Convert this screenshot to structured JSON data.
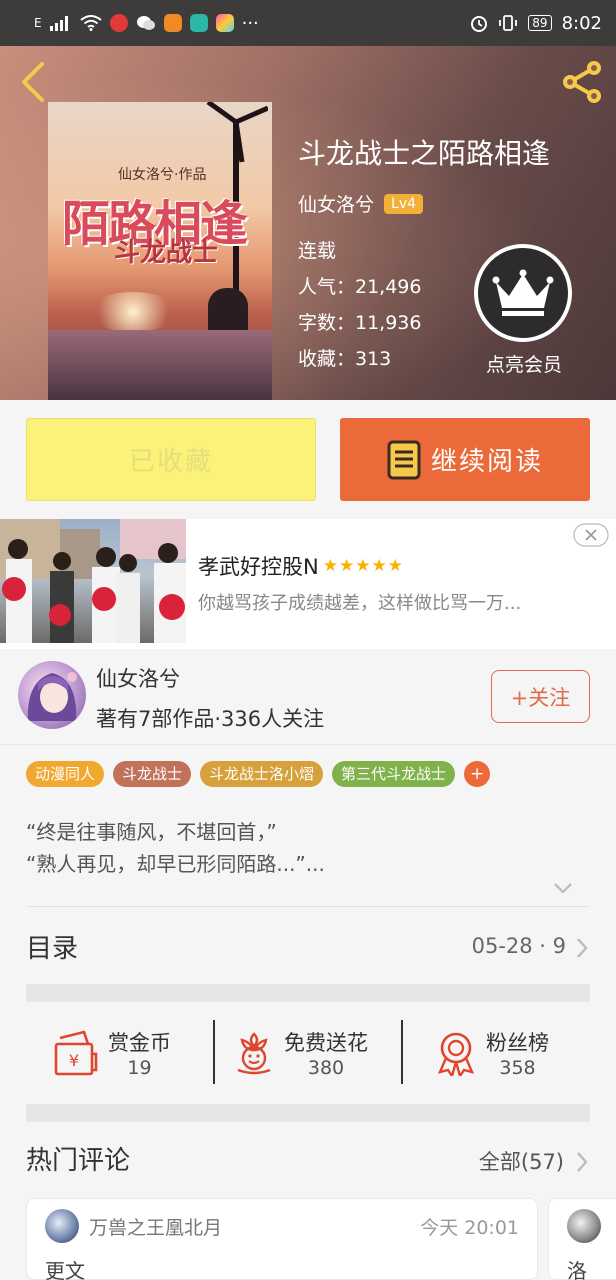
{
  "status_bar": {
    "signal": "E",
    "time": "8:02",
    "battery": "89",
    "more": "···"
  },
  "book": {
    "title": "斗龙战士之陌路相逢",
    "author": "仙女洛兮",
    "level": "Lv4",
    "status": "连载",
    "popularity": "人气：21,496",
    "word_count": "字数：11,936",
    "favorites": "收藏：313",
    "cover": {
      "author_line": "仙女洛兮·作品",
      "title_line": "陌路相逢",
      "subtitle_line": "斗龙战士"
    }
  },
  "vip": {
    "label": "点亮会员"
  },
  "actions": {
    "favorited_label": "已收藏",
    "continue_label": "继续阅读"
  },
  "ad": {
    "title": "孝武好控股N",
    "stars": "★★★★★",
    "description": "你越骂孩子成绩越差，这样做比骂一万..."
  },
  "author_card": {
    "name": "仙女洛兮",
    "stats": "著有7部作品·336人关注",
    "follow_label": "+关注"
  },
  "tags": [
    {
      "label": "动漫同人",
      "color": "#f0a830"
    },
    {
      "label": "斗龙战士",
      "color": "#c0735a"
    },
    {
      "label": "斗龙战士洛小熠",
      "color": "#d6a03a"
    },
    {
      "label": "第三代斗龙战士",
      "color": "#7fb24a"
    }
  ],
  "tag_more": "+",
  "intro": {
    "line1": "“终是往事随风，不堪回首，”",
    "line2": "“熟人再见，却早已形同陌路...”..."
  },
  "toc": {
    "title": "目录",
    "meta": "05-28 · 9"
  },
  "rewards": [
    {
      "label": "赏金币",
      "value": "19",
      "icon": "coin-envelope-icon"
    },
    {
      "label": "免费送花",
      "value": "380",
      "icon": "flower-icon"
    },
    {
      "label": "粉丝榜",
      "value": "358",
      "icon": "medal-icon"
    }
  ],
  "hot_comments": {
    "title": "热门评论",
    "all_label": "全部(57)",
    "items": [
      {
        "user": "万兽之王凰北月",
        "time": "今天 20:01",
        "text": "更文"
      },
      {
        "text": "洛"
      }
    ]
  },
  "colors": {
    "accent_orange": "#ec6a3a",
    "favorite_yellow": "#fbf27a",
    "lv_badge": "#f2b038"
  }
}
